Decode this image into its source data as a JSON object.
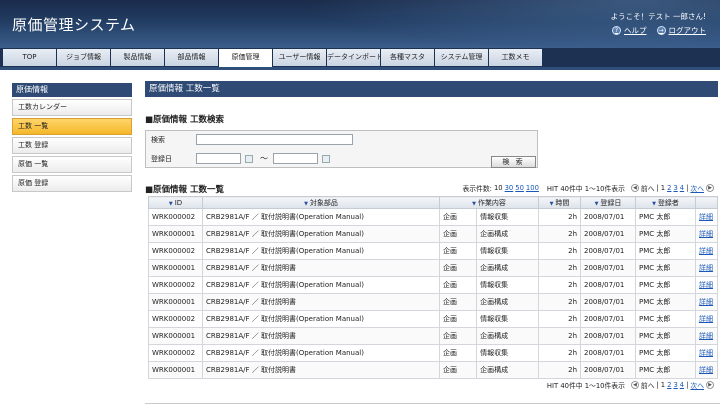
{
  "app": {
    "title": "原価管理システム"
  },
  "header": {
    "welcome": "ようこそ！テスト 一郎さん!",
    "help": "ヘルプ",
    "logout": "ログアウト"
  },
  "tabs": [
    "TOP",
    "ジョブ情報",
    "製品情報",
    "部品情報",
    "原価管理",
    "ユーザー情報",
    "データインポート",
    "各種マスタ",
    "システム管理",
    "工数メモ"
  ],
  "sidebar": {
    "title": "原価情報",
    "items": [
      "工数カレンダー",
      "工数 一覧",
      "工数 登録",
      "原価 一覧",
      "原価 登録"
    ]
  },
  "page": {
    "title": "原価情報 工数一覧"
  },
  "search": {
    "section_title": "■原価情報 工数検索",
    "keyword_label": "検索",
    "keyword_value": "",
    "date_label": "登録日",
    "date_from": "",
    "date_to": "",
    "tilde": "〜",
    "button": "検 索"
  },
  "list": {
    "section_title": "■原価情報 工数一覧",
    "display_count_label": "表示件数:",
    "display_counts": [
      "10",
      "30",
      "50",
      "100"
    ],
    "hit_text": "HIT 40件中 1〜10件表示",
    "prev": "前へ",
    "pages": [
      "1",
      "2",
      "3",
      "4"
    ],
    "next": "次へ",
    "columns": [
      "ID",
      "対象部品",
      "作業内容",
      "時間",
      "登録日",
      "登録者",
      ""
    ],
    "detail_label": "詳細",
    "rows": [
      [
        "WRK000002",
        "CRB2981A/F ／ 取付説明書(Operation Manual)",
        "企画",
        "情報収集",
        "2h",
        "2008/07/01",
        "PMC 太郎"
      ],
      [
        "WRK000001",
        "CRB2981A/F ／ 取付説明書(Operation Manual)",
        "企画",
        "企画構成",
        "2h",
        "2008/07/01",
        "PMC 太郎"
      ],
      [
        "WRK000002",
        "CRB2981A/F ／ 取付説明書(Operation Manual)",
        "企画",
        "情報収集",
        "2h",
        "2008/07/01",
        "PMC 太郎"
      ],
      [
        "WRK000001",
        "CRB2981A/F ／ 取付説明書",
        "企画",
        "企画構成",
        "2h",
        "2008/07/01",
        "PMC 太郎"
      ],
      [
        "WRK000002",
        "CRB2981A/F ／ 取付説明書(Operation Manual)",
        "企画",
        "情報収集",
        "2h",
        "2008/07/01",
        "PMC 太郎"
      ],
      [
        "WRK000001",
        "CRB2981A/F ／ 取付説明書",
        "企画",
        "企画構成",
        "2h",
        "2008/07/01",
        "PMC 太郎"
      ],
      [
        "WRK000002",
        "CRB2981A/F ／ 取付説明書(Operation Manual)",
        "企画",
        "情報収集",
        "2h",
        "2008/07/01",
        "PMC 太郎"
      ],
      [
        "WRK000001",
        "CRB2981A/F ／ 取付説明書",
        "企画",
        "企画構成",
        "2h",
        "2008/07/01",
        "PMC 太郎"
      ],
      [
        "WRK000002",
        "CRB2981A/F ／ 取付説明書(Operation Manual)",
        "企画",
        "情報収集",
        "2h",
        "2008/07/01",
        "PMC 太郎"
      ],
      [
        "WRK000001",
        "CRB2981A/F ／ 取付説明書",
        "企画",
        "企画構成",
        "2h",
        "2008/07/01",
        "PMC 太郎"
      ]
    ]
  },
  "icons": {
    "help": "help-icon",
    "logout": "logout-icon",
    "calendar": "calendar-icon",
    "prev": "prev-arrow-icon",
    "next": "next-arrow-icon"
  },
  "colors": {
    "header_dark": "#1a2b4a",
    "nav_blue": "#2e4a75",
    "active_side": "#f4b72a",
    "link": "#1a58b8"
  }
}
